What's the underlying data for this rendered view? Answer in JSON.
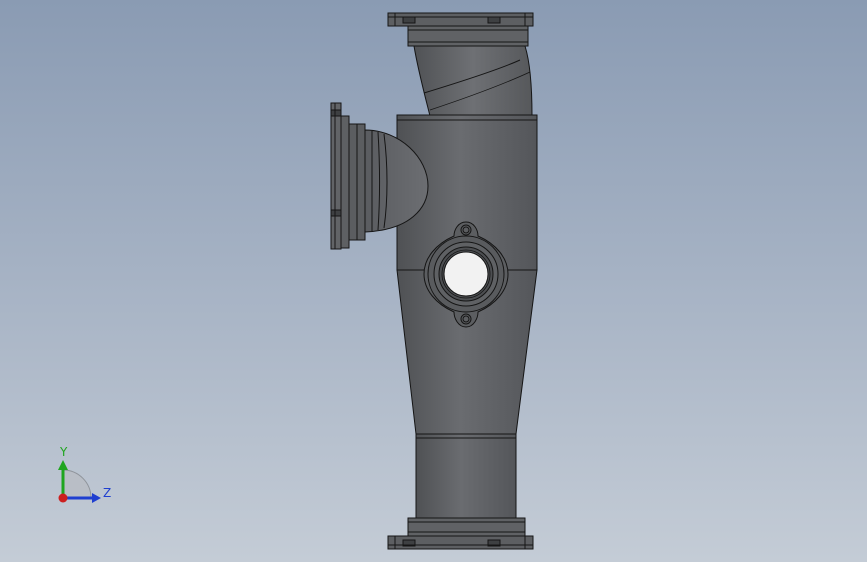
{
  "viewport": {
    "background_top": "#8a9bb3",
    "background_bottom": "#c4ccd6"
  },
  "model": {
    "body_color": "#5f6164",
    "shade_color": "#4a4c4f",
    "edge_color": "#151515"
  },
  "triad": {
    "y_label": "Y",
    "z_label": "Z",
    "y_color": "#1fa51f",
    "z_color": "#1f3fd0",
    "x_color": "#cc1f1f"
  }
}
